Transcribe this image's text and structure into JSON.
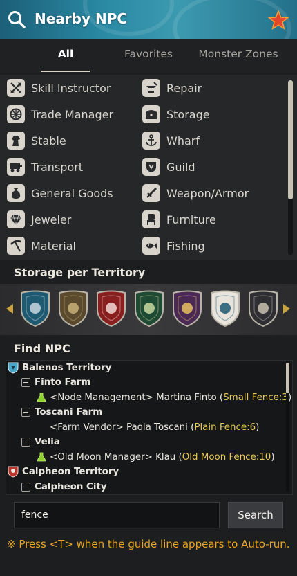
{
  "header": {
    "title": "Nearby NPC"
  },
  "tabs": [
    {
      "label": "All",
      "active": true
    },
    {
      "label": "Favorites",
      "active": false
    },
    {
      "label": "Monster Zones",
      "active": false
    }
  ],
  "categories": [
    {
      "label": "Skill Instructor",
      "icon": "crossed-axes-icon"
    },
    {
      "label": "Repair",
      "icon": "anvil-icon"
    },
    {
      "label": "Trade Manager",
      "icon": "wheel-icon"
    },
    {
      "label": "Storage",
      "icon": "chest-icon"
    },
    {
      "label": "Stable",
      "icon": "horse-icon"
    },
    {
      "label": "Wharf",
      "icon": "anchor-icon"
    },
    {
      "label": "Transport",
      "icon": "wagon-icon"
    },
    {
      "label": "Guild",
      "icon": "guild-crest-icon"
    },
    {
      "label": "General Goods",
      "icon": "sack-icon"
    },
    {
      "label": "Weapon/Armor",
      "icon": "sword-icon"
    },
    {
      "label": "Jeweler",
      "icon": "gem-icon"
    },
    {
      "label": "Furniture",
      "icon": "chair-icon"
    },
    {
      "label": "Material",
      "icon": "pickaxe-icon"
    },
    {
      "label": "Fishing",
      "icon": "fish-icon"
    }
  ],
  "storage_section": {
    "title": "Storage per Territory"
  },
  "territory_shields": [
    {
      "name": "balenos-shield",
      "color": "#1f5a73"
    },
    {
      "name": "serendia-shield",
      "color": "#5b4a2e"
    },
    {
      "name": "calpheon-shield",
      "color": "#8a1f1f"
    },
    {
      "name": "mediah-shield",
      "color": "#1f4a33"
    },
    {
      "name": "valencia-shield",
      "color": "#4a2a55"
    },
    {
      "name": "kamasylvia-shield",
      "color": "#e8e4dc"
    },
    {
      "name": "drieghan-shield",
      "color": "#2e2e33"
    }
  ],
  "find_section": {
    "title": "Find NPC"
  },
  "tree": [
    {
      "type": "territory",
      "label": "Balenos Territory",
      "color": "#4aa6c9"
    },
    {
      "type": "town",
      "label": "Finto Farm"
    },
    {
      "type": "npc",
      "flask": true,
      "prefix": "<Node Management> Martina Finto (",
      "fence": "Small Fence:3",
      "suffix": ")"
    },
    {
      "type": "town",
      "label": "Toscani Farm"
    },
    {
      "type": "npc",
      "flask": false,
      "prefix": "<Farm Vendor> Paola Toscani (",
      "fence": "Plain Fence:6",
      "suffix": ")"
    },
    {
      "type": "town",
      "label": "Velia"
    },
    {
      "type": "npc",
      "flask": true,
      "prefix": "<Old Moon Manager> Klau (",
      "fence": "Old Moon Fence:10",
      "suffix": ")"
    },
    {
      "type": "territory",
      "label": "Calpheon Territory",
      "color": "#b8362b"
    },
    {
      "type": "town",
      "label": "Calpheon City"
    }
  ],
  "search": {
    "value": "fence",
    "button_label": "Search"
  },
  "hint": "※ Press <T> when the guide line appears to Auto-run."
}
